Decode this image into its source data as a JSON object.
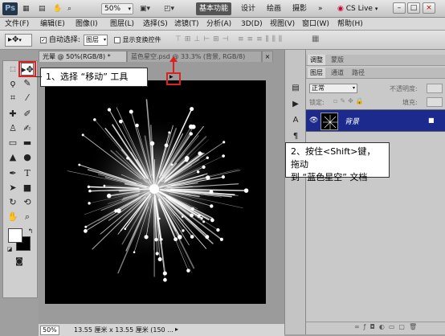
{
  "app": {
    "logo": "Ps"
  },
  "topbar": {
    "zoom": "50%",
    "workspaces": [
      "基本功能",
      "设计",
      "绘画",
      "摄影"
    ],
    "more": "»",
    "cs_live": "CS Live",
    "win_minimize": "–",
    "win_restore": "□",
    "win_close": "×"
  },
  "menu": [
    "文件(F)",
    "编辑(E)",
    "图像(I)",
    "图层(L)",
    "选择(S)",
    "滤镜(T)",
    "分析(A)",
    "3D(D)",
    "视图(V)",
    "窗口(W)",
    "帮助(H)"
  ],
  "options": {
    "auto_select_label": "自动选择:",
    "auto_select_value": "图层",
    "show_transform_label": "显示变换控件"
  },
  "tabs": {
    "doc1": "光晕 @ 50%(RGB/8) *",
    "doc2": "蓝色星空.psd @ 33.3% (背景, RGB/8)",
    "doc2_close": "×"
  },
  "status": {
    "zoom": "50%",
    "info": "13.55 厘米 x 13.55 厘米 (150 ..."
  },
  "panels": {
    "tabs_top": [
      "调整",
      "蒙版"
    ],
    "tabs_layers": [
      "图层",
      "通道",
      "路径"
    ],
    "blend_mode": "正常",
    "opacity_label": "不透明度:",
    "lock_label": "锁定:",
    "fill_label": "填充:",
    "layer_name": "背景"
  },
  "callouts": {
    "step1": "1、选择 “移动” 工具",
    "step2_line1": "2、按住<Shift>键，拖动",
    "step2_line2": "到 “蓝色星空” 文档"
  },
  "colors": {
    "highlight_red": "#e02020",
    "layer_selected": "#1b2a8c"
  }
}
